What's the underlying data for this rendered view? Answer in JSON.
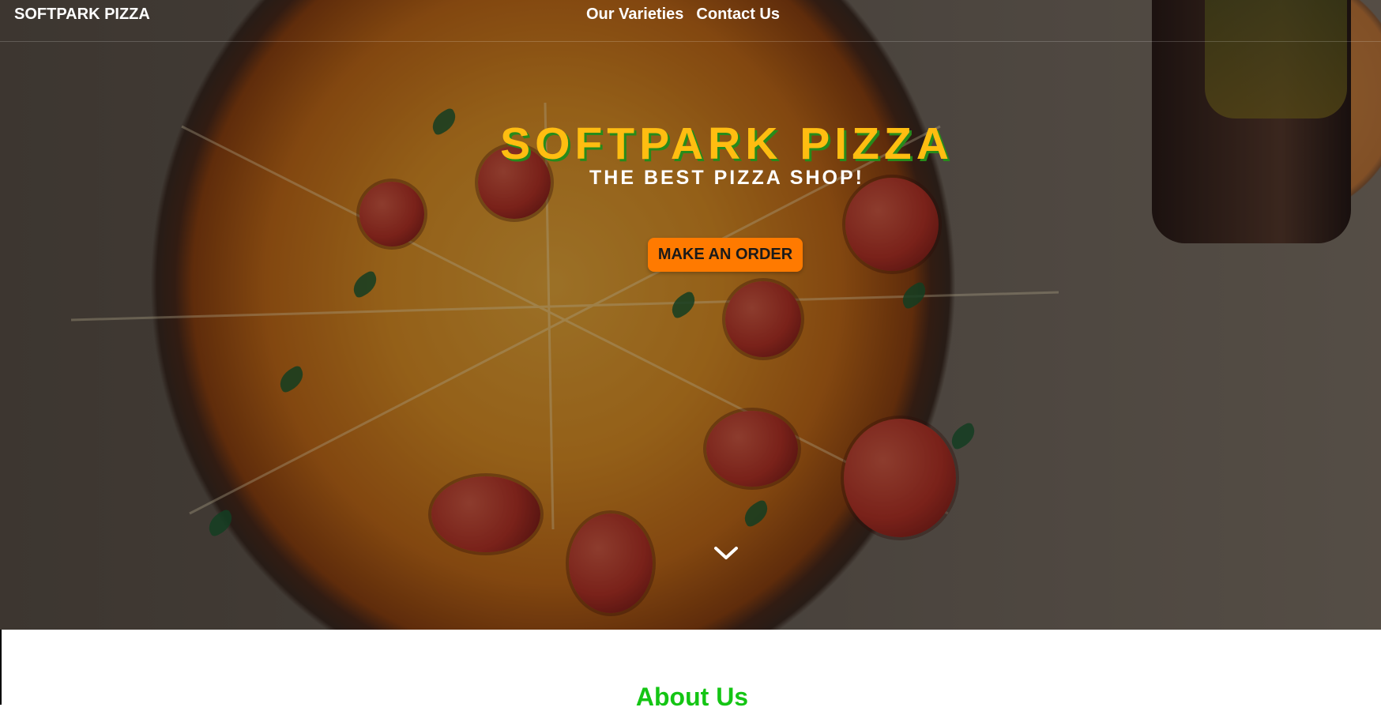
{
  "site": {
    "brand": "SOFTPARK PIZZA"
  },
  "navigation": {
    "items": [
      {
        "label": "Our Varieties"
      },
      {
        "label": "Contact Us"
      }
    ]
  },
  "hero": {
    "title": "SOFTPARK PIZZA",
    "subtitle": "THE BEST PIZZA SHOP!",
    "cta_label": "MAKE AN ORDER",
    "scroll_icon": "chevron-down-icon"
  },
  "about": {
    "title": "About Us"
  },
  "colors": {
    "title_yellow": "#ffbd11",
    "title_shadow_green": "#268b1b",
    "cta_orange": "#ff7a00",
    "about_green": "#14c514"
  }
}
